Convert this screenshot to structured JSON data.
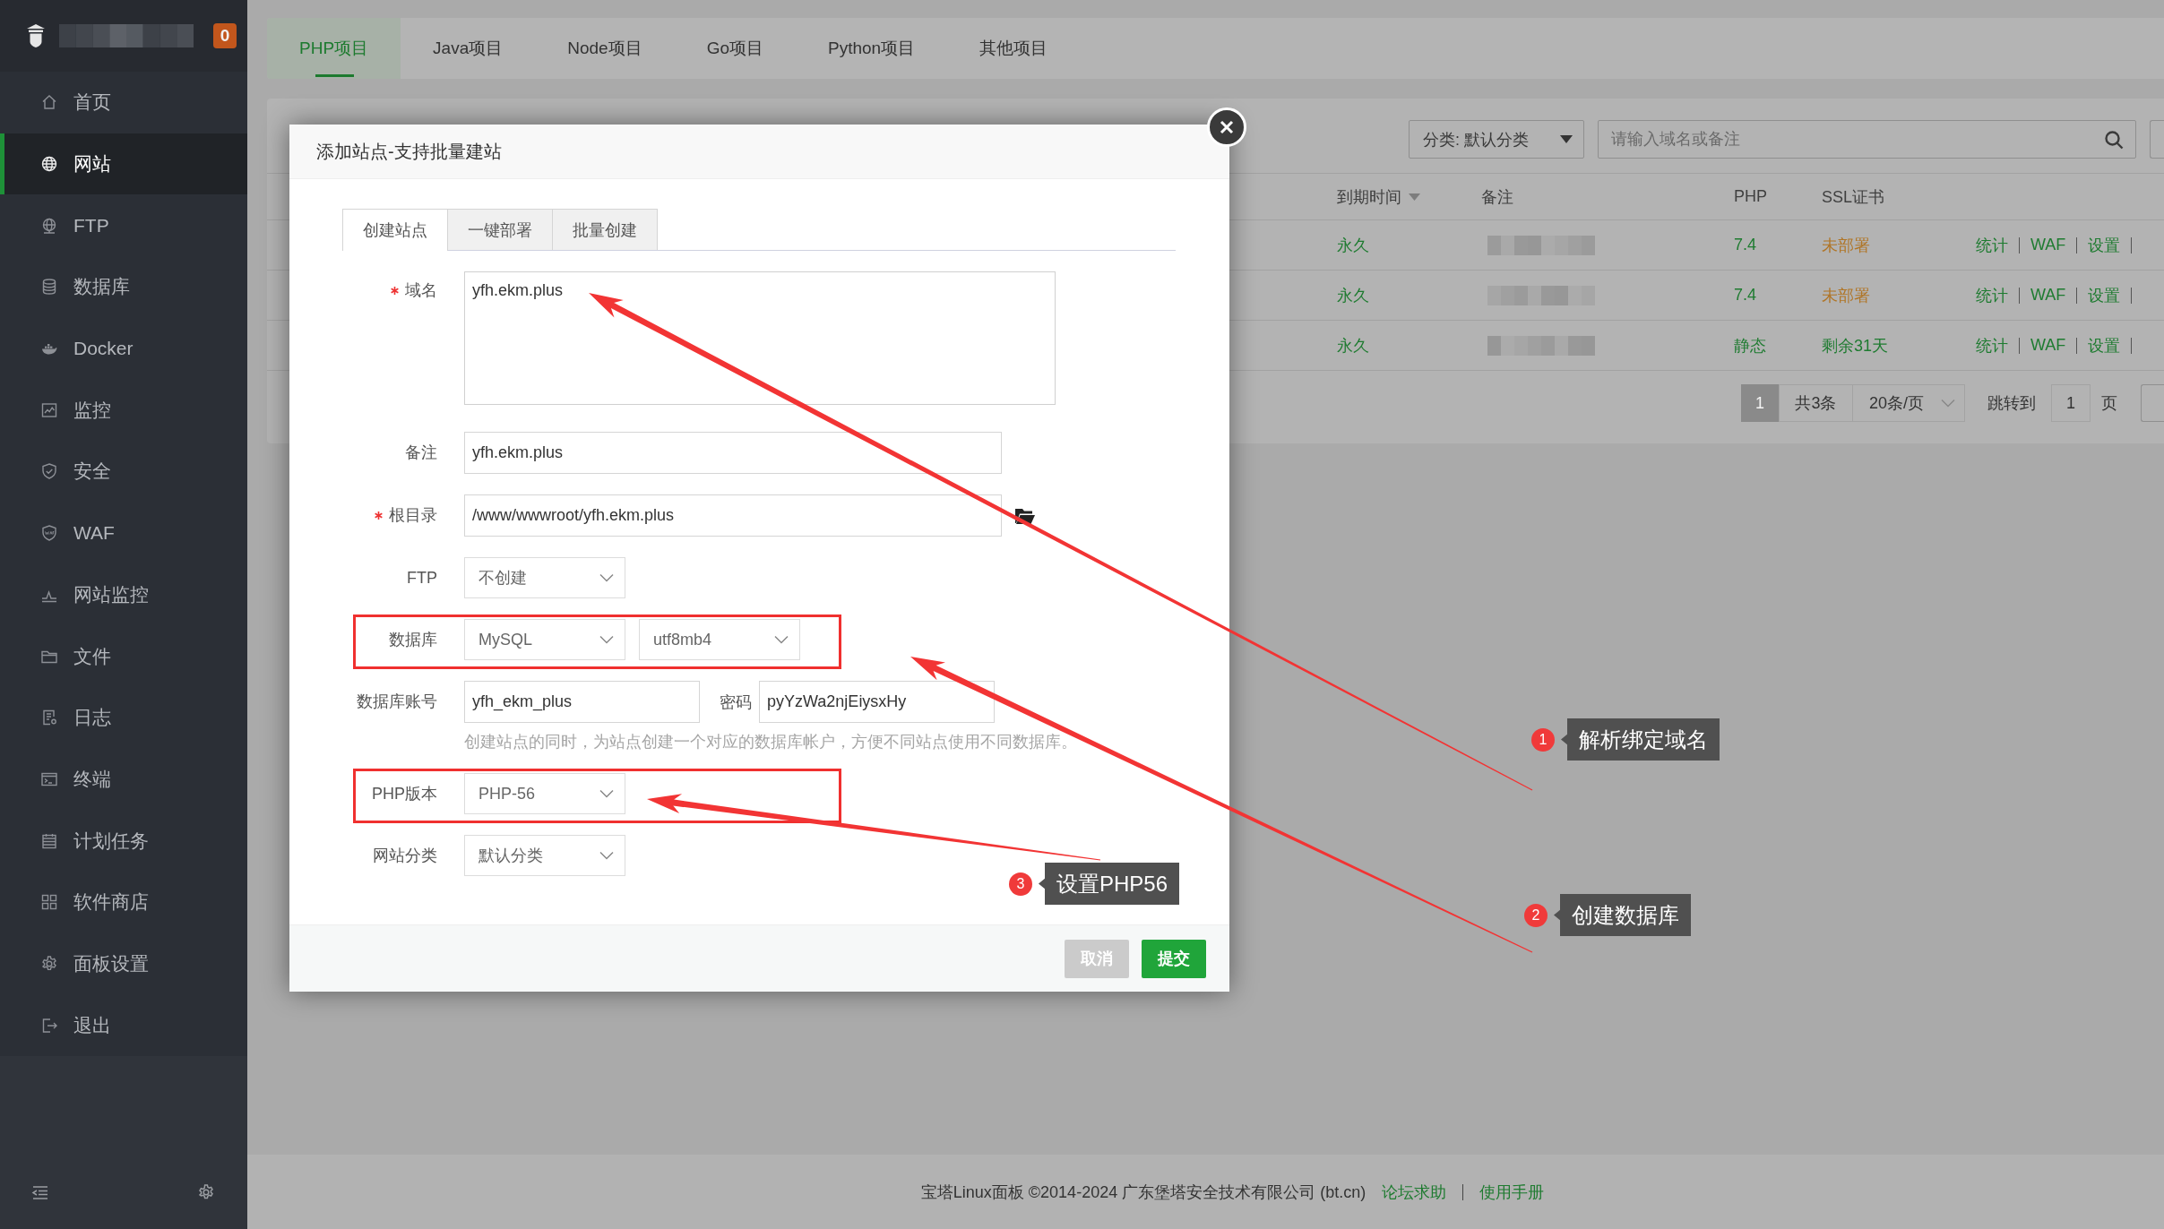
{
  "sidebar": {
    "badge": "0",
    "items": [
      {
        "label": "首页",
        "selected": false
      },
      {
        "label": "网站",
        "selected": true
      },
      {
        "label": "FTP",
        "selected": false
      },
      {
        "label": "数据库",
        "selected": false
      },
      {
        "label": "Docker",
        "selected": false
      },
      {
        "label": "监控",
        "selected": false
      },
      {
        "label": "安全",
        "selected": false
      },
      {
        "label": "WAF",
        "selected": false
      },
      {
        "label": "网站监控",
        "selected": false
      },
      {
        "label": "文件",
        "selected": false
      },
      {
        "label": "日志",
        "selected": false
      },
      {
        "label": "终端",
        "selected": false
      },
      {
        "label": "计划任务",
        "selected": false
      },
      {
        "label": "软件商店",
        "selected": false
      },
      {
        "label": "面板设置",
        "selected": false
      },
      {
        "label": "退出",
        "selected": false
      }
    ]
  },
  "project_tabs": [
    {
      "label": "PHP项目",
      "selected": true
    },
    {
      "label": "Java项目",
      "selected": false
    },
    {
      "label": "Node项目",
      "selected": false
    },
    {
      "label": "Go项目",
      "selected": false
    },
    {
      "label": "Python项目",
      "selected": false
    },
    {
      "label": "其他项目",
      "selected": false
    }
  ],
  "toolbar": {
    "category": "分类: 默认分类",
    "search": {
      "placeholder": "请输入域名或备注"
    }
  },
  "table": {
    "columns": [
      {
        "label": "到期时间",
        "sortable": true
      },
      {
        "label": "备注",
        "sortable": false
      },
      {
        "label": "PHP",
        "sortable": false
      },
      {
        "label": "SSL证书",
        "sortable": false
      }
    ],
    "rows": [
      {
        "expiry": "永久",
        "php": "7.4",
        "ssl": "未部署",
        "ssl_warning": true,
        "actions": [
          "统计",
          "WAF",
          "设置"
        ]
      },
      {
        "expiry": "永久",
        "php": "7.4",
        "ssl": "未部署",
        "ssl_warning": true,
        "actions": [
          "统计",
          "WAF",
          "设置"
        ]
      },
      {
        "expiry": "永久",
        "php": "静态",
        "ssl": "剩余31天",
        "ssl_warning": false,
        "actions": [
          "统计",
          "WAF",
          "设置"
        ]
      }
    ]
  },
  "pagination": {
    "pages": [
      {
        "label": "1",
        "selected": true
      }
    ],
    "total": "共3条",
    "page_size": "20条/页",
    "jump_label": "跳转到",
    "jump_value": "1",
    "page_unit": "页"
  },
  "dialog": {
    "title": "添加站点-支持批量建站",
    "tabs": [
      {
        "label": "创建站点",
        "selected": true
      },
      {
        "label": "一键部署",
        "selected": false
      },
      {
        "label": "批量创建",
        "selected": false
      }
    ],
    "fields": [
      {
        "label": "域名",
        "required": true,
        "highlighted": false,
        "controls": [
          {
            "kind": "textarea",
            "value": "yfh.ekm.plus"
          }
        ]
      },
      {
        "label": "备注",
        "required": false,
        "highlighted": false,
        "controls": [
          {
            "kind": "input",
            "value": "yfh.ekm.plus"
          }
        ]
      },
      {
        "label": "根目录",
        "required": true,
        "highlighted": false,
        "controls": [
          {
            "kind": "path",
            "value": "/www/wwwroot/yfh.ekm.plus"
          }
        ]
      },
      {
        "label": "FTP",
        "required": false,
        "highlighted": false,
        "controls": [
          {
            "kind": "select",
            "value": "不创建"
          }
        ]
      },
      {
        "label": "数据库",
        "required": false,
        "highlighted": true,
        "controls": [
          {
            "kind": "select",
            "value": "MySQL"
          },
          {
            "kind": "select",
            "value": "utf8mb4"
          }
        ]
      },
      {
        "label": "数据库账号",
        "required": false,
        "highlighted": false,
        "controls": [
          {
            "kind": "short_input",
            "value": "yfh_ekm_plus"
          },
          {
            "kind": "label",
            "text": "密码"
          },
          {
            "kind": "short_input",
            "value": "pyYzWa2njEiysxHy"
          }
        ],
        "help": "创建站点的同时，为站点创建一个对应的数据库帐户，方便不同站点使用不同数据库。"
      },
      {
        "label": "PHP版本",
        "required": false,
        "highlighted": true,
        "controls": [
          {
            "kind": "select",
            "value": "PHP-56"
          }
        ]
      },
      {
        "label": "网站分类",
        "required": false,
        "highlighted": false,
        "controls": [
          {
            "kind": "select",
            "value": "默认分类"
          }
        ]
      }
    ],
    "buttons": [
      {
        "label": "取消",
        "kind": "cancel"
      },
      {
        "label": "提交",
        "kind": "primary"
      }
    ]
  },
  "annotations": [
    {
      "number": "1",
      "label": "解析绑定域名"
    },
    {
      "number": "2",
      "label": "创建数据库"
    },
    {
      "number": "3",
      "label": "设置PHP56"
    }
  ],
  "footer": {
    "copyright": "宝塔Linux面板 ©2014-2024 广东堡塔安全技术有限公司 (bt.cn)",
    "links": [
      "论坛求助",
      "使用手册"
    ]
  }
}
